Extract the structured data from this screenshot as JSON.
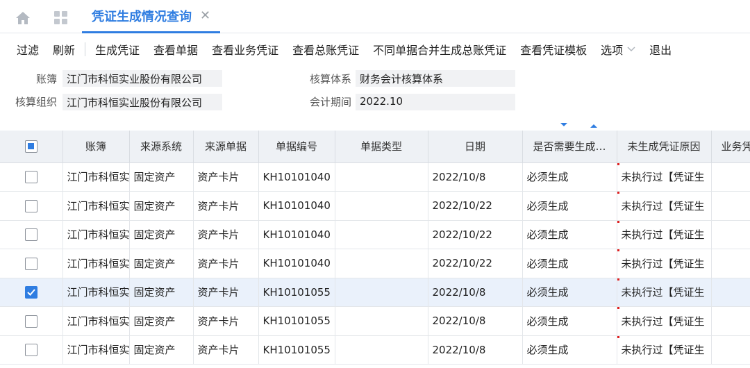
{
  "tab": {
    "title": "凭证生成情况查询",
    "close": "✕"
  },
  "toolbar": {
    "filter": "过滤",
    "refresh": "刷新",
    "generate_voucher": "生成凭证",
    "view_document": "查看单据",
    "view_business_voucher": "查看业务凭证",
    "view_ledger_voucher": "查看总账凭证",
    "merge_ledger_voucher": "不同单据合并生成总账凭证",
    "view_voucher_template": "查看凭证模板",
    "options": "选项",
    "exit": "退出"
  },
  "form": {
    "book_label": "账簿",
    "book_value": "江门市科恒实业股份有限公司",
    "org_label": "核算组织",
    "org_value": "江门市科恒实业股份有限公司",
    "system_label": "核算体系",
    "system_value": "财务会计核算体系",
    "period_label": "会计期间",
    "period_value": "2022.10"
  },
  "columns": [
    "账簿",
    "来源系统",
    "来源单据",
    "单据编号",
    "单据类型",
    "日期",
    "是否需要生成…",
    "未生成凭证原因",
    "业务凭"
  ],
  "rows": [
    {
      "checked": false,
      "book": "江门市科恒实",
      "system": "固定资产",
      "source": "资产卡片",
      "number": "KH10101040",
      "type": "",
      "date": "2022/10/8",
      "need": "必须生成",
      "reason": "未执行过【凭证生"
    },
    {
      "checked": false,
      "book": "江门市科恒实",
      "system": "固定资产",
      "source": "资产卡片",
      "number": "KH10101040",
      "type": "",
      "date": "2022/10/22",
      "need": "必须生成",
      "reason": "未执行过【凭证生"
    },
    {
      "checked": false,
      "book": "江门市科恒实",
      "system": "固定资产",
      "source": "资产卡片",
      "number": "KH10101040",
      "type": "",
      "date": "2022/10/22",
      "need": "必须生成",
      "reason": "未执行过【凭证生"
    },
    {
      "checked": false,
      "book": "江门市科恒实",
      "system": "固定资产",
      "source": "资产卡片",
      "number": "KH10101040",
      "type": "",
      "date": "2022/10/22",
      "need": "必须生成",
      "reason": "未执行过【凭证生"
    },
    {
      "checked": true,
      "book": "江门市科恒实",
      "system": "固定资产",
      "source": "资产卡片",
      "number": "KH10101055",
      "type": "",
      "date": "2022/10/8",
      "need": "必须生成",
      "reason": "未执行过【凭证生"
    },
    {
      "checked": false,
      "book": "江门市科恒实",
      "system": "固定资产",
      "source": "资产卡片",
      "number": "KH10101055",
      "type": "",
      "date": "2022/10/8",
      "need": "必须生成",
      "reason": "未执行过【凭证生"
    },
    {
      "checked": false,
      "book": "江门市科恒实",
      "system": "固定资产",
      "source": "资产卡片",
      "number": "KH10101055",
      "type": "",
      "date": "2022/10/8",
      "need": "必须生成",
      "reason": "未执行过【凭证生"
    }
  ],
  "colors": {
    "accent": "#2f7de1",
    "header_bg": "#eef1f5",
    "selected_row": "#eaf1fb"
  }
}
